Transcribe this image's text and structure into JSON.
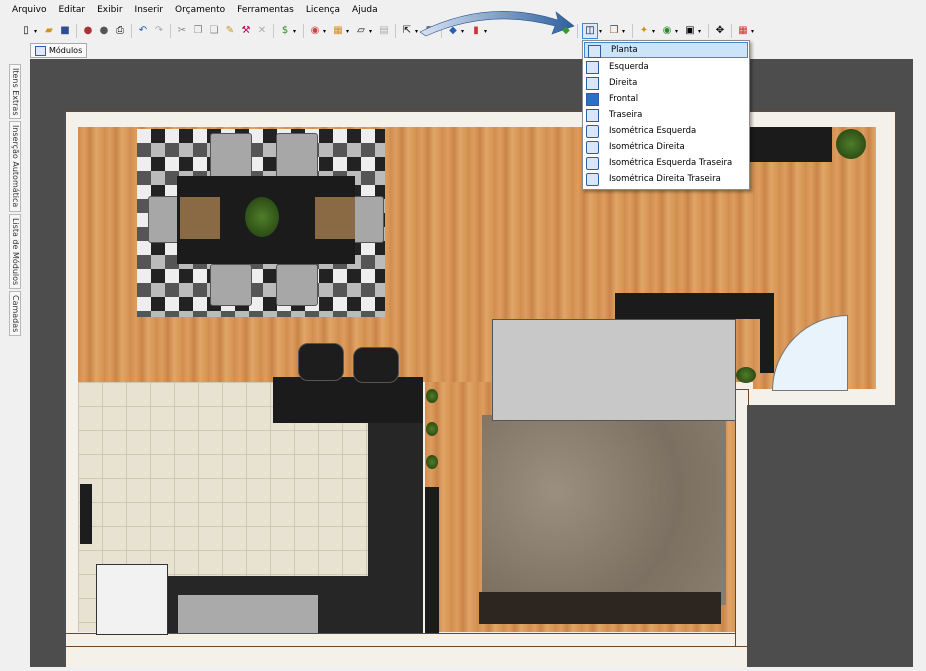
{
  "menu": [
    "Arquivo",
    "Editar",
    "Exibir",
    "Inserir",
    "Orçamento",
    "Ferramentas",
    "Licença",
    "Ajuda"
  ],
  "tab": {
    "label": "Módulos"
  },
  "side_panels": [
    "Itens Extras",
    "Inserção Automática",
    "Lista de Módulos",
    "Camadas"
  ],
  "view_menu": {
    "items": [
      "Planta",
      "Esquerda",
      "Direita",
      "Frontal",
      "Traseira",
      "Isométrica Esquerda",
      "Isométrica Direita",
      "Isométrica Esquerda Traseira",
      "Isométrica Direita Traseira"
    ],
    "selected": "Planta"
  },
  "colors": {
    "accent": "#3c88d6",
    "viewport_bg": "#4d4d4d",
    "floor": "#d49251"
  },
  "icons": [
    "new-icon",
    "open-icon",
    "save-icon",
    "print-icon",
    "undo-icon",
    "redo-icon",
    "cut-icon",
    "copy-icon",
    "paste-icon",
    "delete-icon",
    "select-icon",
    "view-icon",
    "render-icon",
    "color-icon"
  ]
}
